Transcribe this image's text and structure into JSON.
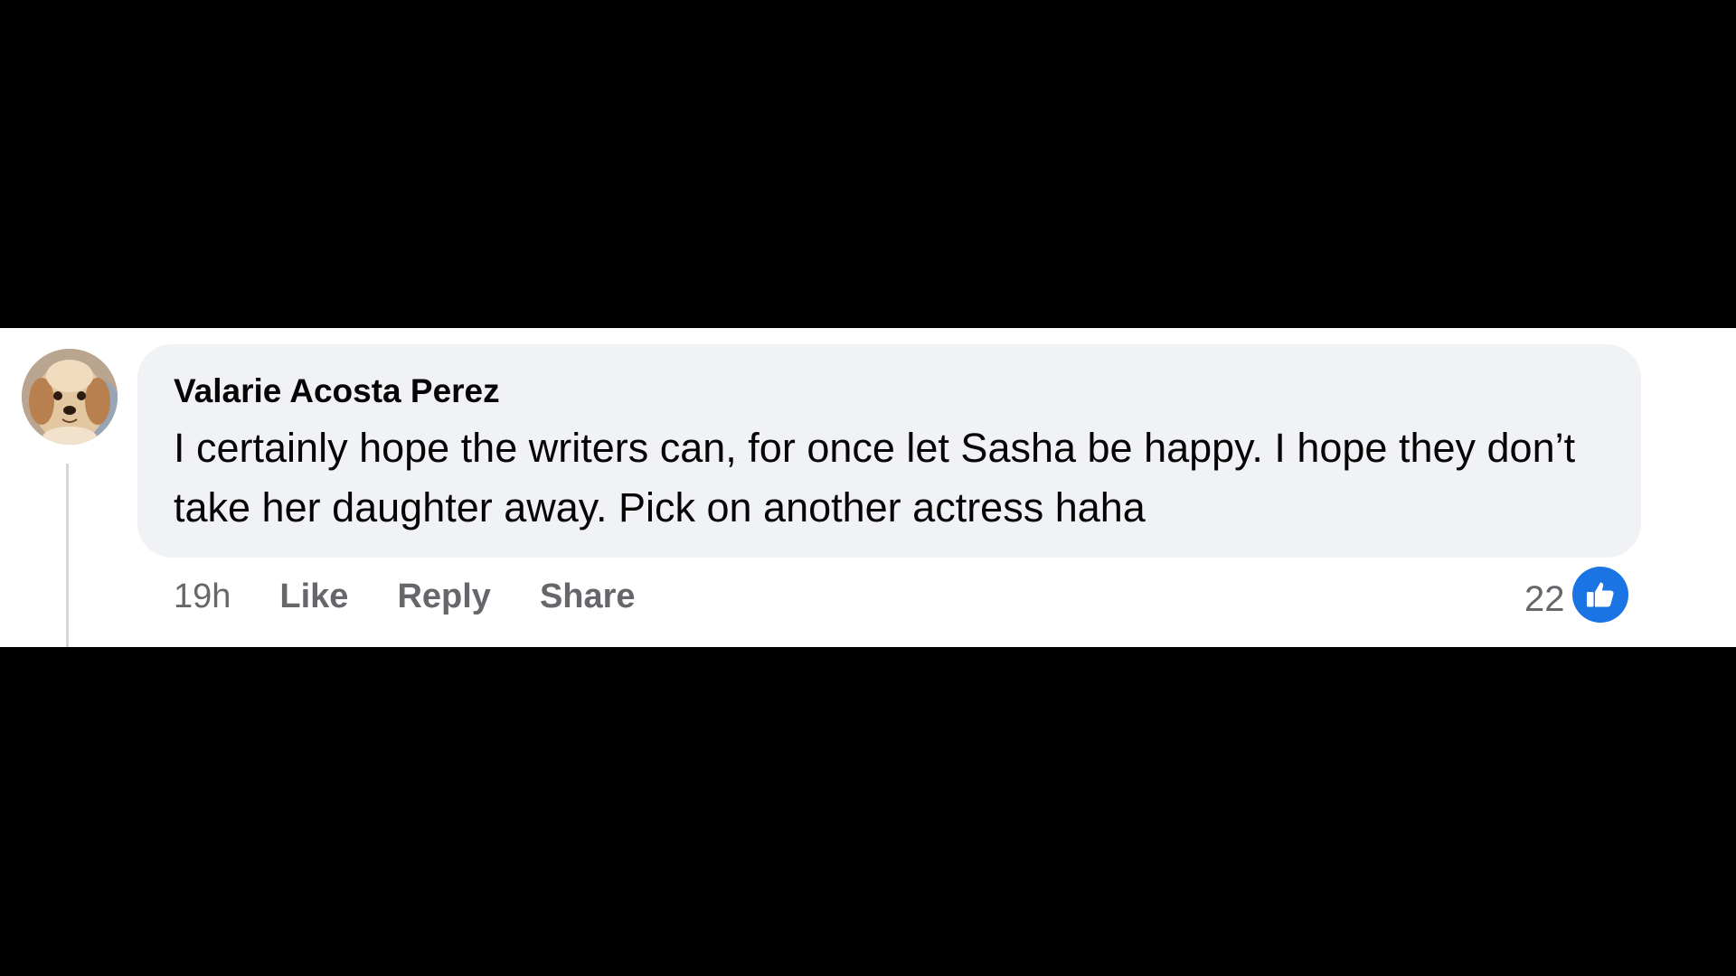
{
  "comment": {
    "author": "Valarie Acosta Perez",
    "text": "I certainly hope the writers can, for once let Sasha be happy. I hope they don’t take her daughter away. Pick on another actress haha",
    "avatar_icon": "dog-avatar",
    "time": "19h",
    "actions": {
      "like": "Like",
      "reply": "Reply",
      "share": "Share"
    },
    "reactions": {
      "count": "22",
      "icon": "thumbs-up-icon",
      "color": "#1b74e4"
    }
  }
}
